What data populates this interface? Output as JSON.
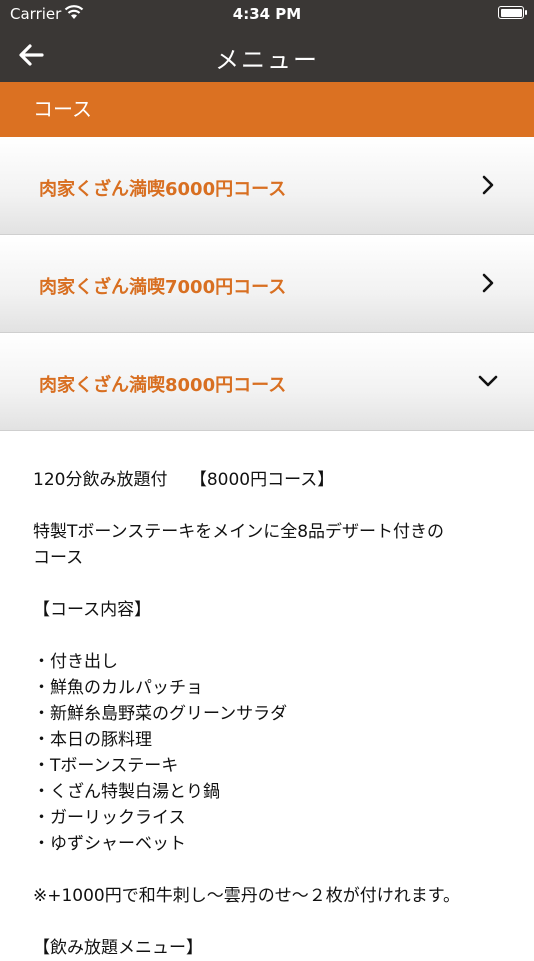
{
  "status_bar": {
    "carrier": "Carrier",
    "time": "4:34 PM"
  },
  "nav": {
    "title": "メニュー"
  },
  "section": {
    "header": "コース"
  },
  "courses": [
    {
      "label": "肉家くざん満喫6000円コース",
      "state": "collapsed"
    },
    {
      "label": "肉家くざん満喫7000円コース",
      "state": "collapsed"
    },
    {
      "label": "肉家くざん満喫8000円コース",
      "state": "expanded"
    }
  ],
  "detail": {
    "heading": "120分飲み放題付　 【8000円コース】",
    "description_1": "特製Tボーンステーキをメインに全8品デザート付きの",
    "description_2": "コース",
    "contents_title": "【コース内容】",
    "items": [
      "・付き出し",
      "・鮮魚のカルパッチョ",
      "・新鮮糸島野菜のグリーンサラダ",
      "・本日の豚料理",
      "・Tボーンステーキ",
      "・くざん特製白湯とり鍋",
      "・ガーリックライス",
      "・ゆずシャーベット"
    ],
    "note": "※+1000円で和牛刺し～雲丹のせ～２枚が付けれます。",
    "drinks_title": "【飲み放題メニュー】"
  },
  "colors": {
    "nav_bg": "#3a3735",
    "accent": "#db7122",
    "label_text": "#d86f21"
  }
}
